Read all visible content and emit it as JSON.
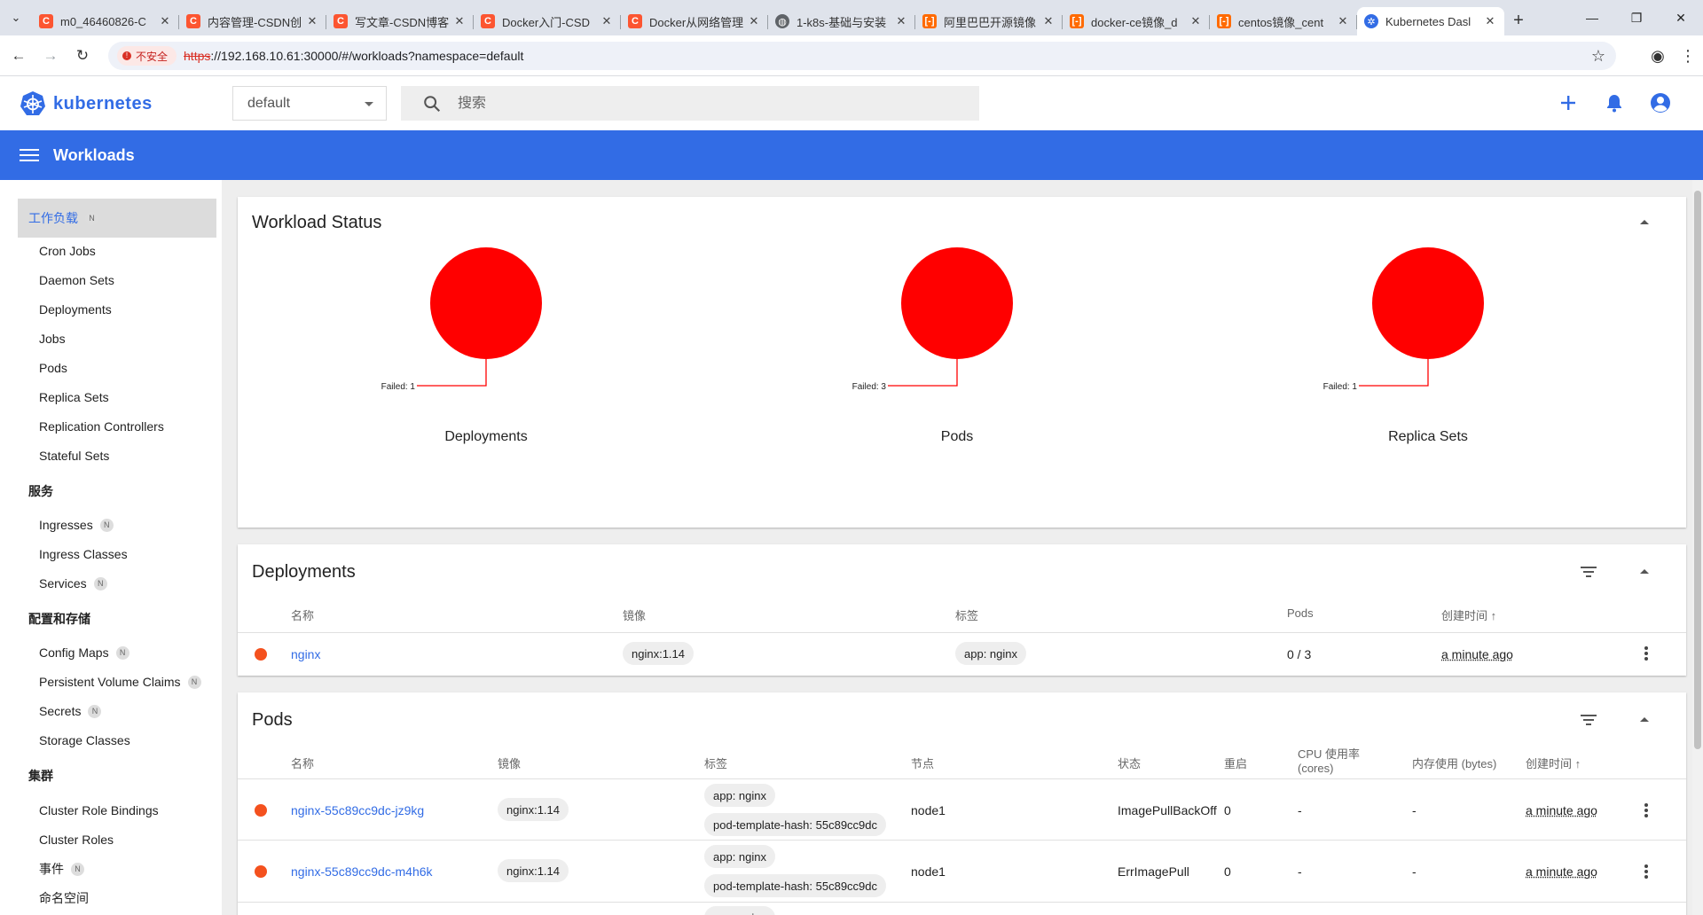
{
  "browser": {
    "tabs": [
      {
        "title": "m0_46460826-C",
        "favicon": "csdn-icon"
      },
      {
        "title": "内容管理-CSDN创",
        "favicon": "csdn-icon"
      },
      {
        "title": "写文章-CSDN博客",
        "favicon": "csdn-icon"
      },
      {
        "title": "Docker入门-CSD",
        "favicon": "csdn-icon"
      },
      {
        "title": "Docker从网络管理",
        "favicon": "csdn-icon"
      },
      {
        "title": "1-k8s-基础与安装",
        "favicon": "globe-icon"
      },
      {
        "title": "阿里巴巴开源镜像",
        "favicon": "aliyun-icon"
      },
      {
        "title": "docker-ce镜像_d",
        "favicon": "aliyun-icon"
      },
      {
        "title": "centos镜像_cent",
        "favicon": "aliyun-icon"
      },
      {
        "title": "Kubernetes Dasl",
        "favicon": "kubernetes-icon"
      }
    ],
    "security_label": "不安全",
    "url_scheme": "https",
    "url_rest": "://192.168.10.61:30000/#/workloads?namespace=default"
  },
  "app": {
    "brand": "kubernetes",
    "namespace": "default",
    "search_placeholder": "搜索",
    "page_title": "Workloads"
  },
  "sidebar": {
    "badge": "N",
    "sections": [
      {
        "label": "工作负载",
        "badge": true,
        "active": true
      },
      {
        "label": "服务"
      },
      {
        "label": "配置和存储"
      },
      {
        "label": "集群"
      }
    ],
    "workloads": [
      "Cron Jobs",
      "Daemon Sets",
      "Deployments",
      "Jobs",
      "Pods",
      "Replica Sets",
      "Replication Controllers",
      "Stateful Sets"
    ],
    "services": [
      {
        "label": "Ingresses",
        "badge": true
      },
      {
        "label": "Ingress Classes"
      },
      {
        "label": "Services",
        "badge": true
      }
    ],
    "config": [
      {
        "label": "Config Maps",
        "badge": true
      },
      {
        "label": "Persistent Volume Claims",
        "badge": true
      },
      {
        "label": "Secrets",
        "badge": true
      },
      {
        "label": "Storage Classes"
      }
    ],
    "cluster": [
      {
        "label": "Cluster Role Bindings"
      },
      {
        "label": "Cluster Roles"
      },
      {
        "label": "事件",
        "badge": true
      },
      {
        "label": "命名空间"
      }
    ]
  },
  "workload_status": {
    "title": "Workload Status",
    "failed_color": "#ff0000",
    "charts": [
      {
        "name": "Deployments",
        "failed_label": "Failed: 1"
      },
      {
        "name": "Pods",
        "failed_label": "Failed: 3"
      },
      {
        "name": "Replica Sets",
        "failed_label": "Failed: 1"
      }
    ]
  },
  "chart_data": [
    {
      "type": "pie",
      "title": "Deployments",
      "series": [
        {
          "name": "Failed",
          "values": [
            1
          ]
        }
      ]
    },
    {
      "type": "pie",
      "title": "Pods",
      "series": [
        {
          "name": "Failed",
          "values": [
            3
          ]
        }
      ]
    },
    {
      "type": "pie",
      "title": "Replica Sets",
      "series": [
        {
          "name": "Failed",
          "values": [
            1
          ]
        }
      ]
    }
  ],
  "deployments": {
    "title": "Deployments",
    "columns": {
      "name": "名称",
      "image": "镜像",
      "labels": "标签",
      "pods": "Pods",
      "created": "创建时间"
    },
    "sort_arrow": "↑",
    "status_color": "#f4511e",
    "rows": [
      {
        "name": "nginx",
        "image": "nginx:1.14",
        "label": "app: nginx",
        "pods": "0 / 3",
        "created": "a minute ago"
      }
    ]
  },
  "pods": {
    "title": "Pods",
    "columns": {
      "name": "名称",
      "image": "镜像",
      "labels": "标签",
      "node": "节点",
      "status": "状态",
      "restarts": "重启",
      "cpu": "CPU 使用率",
      "cpu_unit": "(cores)",
      "memory": "内存使用 (bytes)",
      "created": "创建时间"
    },
    "sort_arrow": "↑",
    "rows": [
      {
        "name": "nginx-55c89cc9dc-jz9kg",
        "image": "nginx:1.14",
        "label1": "app: nginx",
        "label2": "pod-template-hash: 55c89cc9dc",
        "node": "node1",
        "status": "ImagePullBackOff",
        "restarts": "0",
        "cpu": "-",
        "memory": "-",
        "created": "a minute ago"
      },
      {
        "name": "nginx-55c89cc9dc-m4h6k",
        "image": "nginx:1.14",
        "label1": "app: nginx",
        "label2": "pod-template-hash: 55c89cc9dc",
        "node": "node1",
        "status": "ErrImagePull",
        "restarts": "0",
        "cpu": "-",
        "memory": "-",
        "created": "a minute ago"
      }
    ],
    "partial_row_label": "app: nginx"
  }
}
